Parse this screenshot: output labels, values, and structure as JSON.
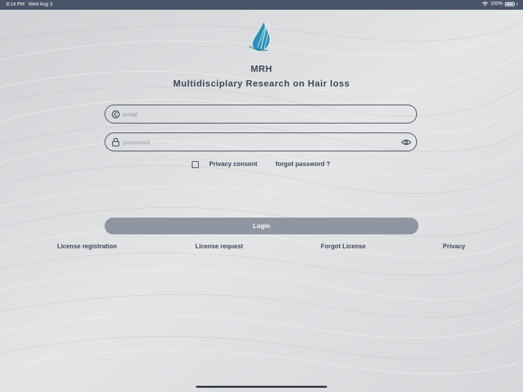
{
  "status_bar": {
    "time": "8:14 PM",
    "date": "Wed Aug 3",
    "battery": "100%"
  },
  "app": {
    "name": "MRH",
    "subtitle": "Multidisciplary Research on Hair loss"
  },
  "form": {
    "email_placeholder": "email",
    "password_placeholder": "password",
    "privacy_consent_label": "Privacy consent",
    "forgot_password_label": "forgot password ?",
    "login_label": "Login"
  },
  "footer": {
    "license_registration": "License registration",
    "license_request": "License request",
    "forgot_license": "Forgot License",
    "privacy": "Privacy"
  },
  "colors": {
    "accent": "#3f4757",
    "button": "#8f96a2",
    "status_bar": "#4a5468",
    "logo": "#2a8fb5"
  }
}
